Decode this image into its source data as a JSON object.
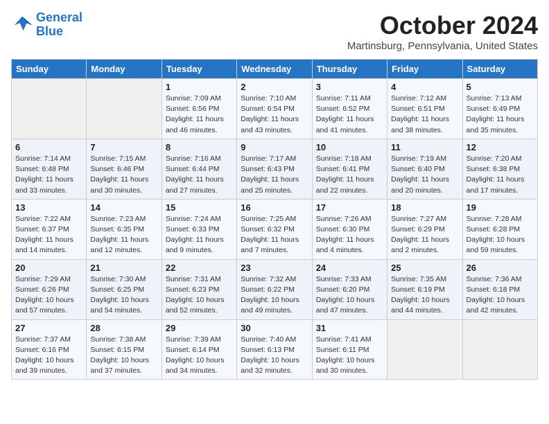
{
  "logo": {
    "line1": "General",
    "line2": "Blue"
  },
  "header": {
    "month": "October 2024",
    "location": "Martinsburg, Pennsylvania, United States"
  },
  "weekdays": [
    "Sunday",
    "Monday",
    "Tuesday",
    "Wednesday",
    "Thursday",
    "Friday",
    "Saturday"
  ],
  "weeks": [
    [
      {
        "num": "",
        "detail": ""
      },
      {
        "num": "",
        "detail": ""
      },
      {
        "num": "1",
        "detail": "Sunrise: 7:09 AM\nSunset: 6:56 PM\nDaylight: 11 hours and 46 minutes."
      },
      {
        "num": "2",
        "detail": "Sunrise: 7:10 AM\nSunset: 6:54 PM\nDaylight: 11 hours and 43 minutes."
      },
      {
        "num": "3",
        "detail": "Sunrise: 7:11 AM\nSunset: 6:52 PM\nDaylight: 11 hours and 41 minutes."
      },
      {
        "num": "4",
        "detail": "Sunrise: 7:12 AM\nSunset: 6:51 PM\nDaylight: 11 hours and 38 minutes."
      },
      {
        "num": "5",
        "detail": "Sunrise: 7:13 AM\nSunset: 6:49 PM\nDaylight: 11 hours and 35 minutes."
      }
    ],
    [
      {
        "num": "6",
        "detail": "Sunrise: 7:14 AM\nSunset: 6:48 PM\nDaylight: 11 hours and 33 minutes."
      },
      {
        "num": "7",
        "detail": "Sunrise: 7:15 AM\nSunset: 6:46 PM\nDaylight: 11 hours and 30 minutes."
      },
      {
        "num": "8",
        "detail": "Sunrise: 7:16 AM\nSunset: 6:44 PM\nDaylight: 11 hours and 27 minutes."
      },
      {
        "num": "9",
        "detail": "Sunrise: 7:17 AM\nSunset: 6:43 PM\nDaylight: 11 hours and 25 minutes."
      },
      {
        "num": "10",
        "detail": "Sunrise: 7:18 AM\nSunset: 6:41 PM\nDaylight: 11 hours and 22 minutes."
      },
      {
        "num": "11",
        "detail": "Sunrise: 7:19 AM\nSunset: 6:40 PM\nDaylight: 11 hours and 20 minutes."
      },
      {
        "num": "12",
        "detail": "Sunrise: 7:20 AM\nSunset: 6:38 PM\nDaylight: 11 hours and 17 minutes."
      }
    ],
    [
      {
        "num": "13",
        "detail": "Sunrise: 7:22 AM\nSunset: 6:37 PM\nDaylight: 11 hours and 14 minutes."
      },
      {
        "num": "14",
        "detail": "Sunrise: 7:23 AM\nSunset: 6:35 PM\nDaylight: 11 hours and 12 minutes."
      },
      {
        "num": "15",
        "detail": "Sunrise: 7:24 AM\nSunset: 6:33 PM\nDaylight: 11 hours and 9 minutes."
      },
      {
        "num": "16",
        "detail": "Sunrise: 7:25 AM\nSunset: 6:32 PM\nDaylight: 11 hours and 7 minutes."
      },
      {
        "num": "17",
        "detail": "Sunrise: 7:26 AM\nSunset: 6:30 PM\nDaylight: 11 hours and 4 minutes."
      },
      {
        "num": "18",
        "detail": "Sunrise: 7:27 AM\nSunset: 6:29 PM\nDaylight: 11 hours and 2 minutes."
      },
      {
        "num": "19",
        "detail": "Sunrise: 7:28 AM\nSunset: 6:28 PM\nDaylight: 10 hours and 59 minutes."
      }
    ],
    [
      {
        "num": "20",
        "detail": "Sunrise: 7:29 AM\nSunset: 6:26 PM\nDaylight: 10 hours and 57 minutes."
      },
      {
        "num": "21",
        "detail": "Sunrise: 7:30 AM\nSunset: 6:25 PM\nDaylight: 10 hours and 54 minutes."
      },
      {
        "num": "22",
        "detail": "Sunrise: 7:31 AM\nSunset: 6:23 PM\nDaylight: 10 hours and 52 minutes."
      },
      {
        "num": "23",
        "detail": "Sunrise: 7:32 AM\nSunset: 6:22 PM\nDaylight: 10 hours and 49 minutes."
      },
      {
        "num": "24",
        "detail": "Sunrise: 7:33 AM\nSunset: 6:20 PM\nDaylight: 10 hours and 47 minutes."
      },
      {
        "num": "25",
        "detail": "Sunrise: 7:35 AM\nSunset: 6:19 PM\nDaylight: 10 hours and 44 minutes."
      },
      {
        "num": "26",
        "detail": "Sunrise: 7:36 AM\nSunset: 6:18 PM\nDaylight: 10 hours and 42 minutes."
      }
    ],
    [
      {
        "num": "27",
        "detail": "Sunrise: 7:37 AM\nSunset: 6:16 PM\nDaylight: 10 hours and 39 minutes."
      },
      {
        "num": "28",
        "detail": "Sunrise: 7:38 AM\nSunset: 6:15 PM\nDaylight: 10 hours and 37 minutes."
      },
      {
        "num": "29",
        "detail": "Sunrise: 7:39 AM\nSunset: 6:14 PM\nDaylight: 10 hours and 34 minutes."
      },
      {
        "num": "30",
        "detail": "Sunrise: 7:40 AM\nSunset: 6:13 PM\nDaylight: 10 hours and 32 minutes."
      },
      {
        "num": "31",
        "detail": "Sunrise: 7:41 AM\nSunset: 6:11 PM\nDaylight: 10 hours and 30 minutes."
      },
      {
        "num": "",
        "detail": ""
      },
      {
        "num": "",
        "detail": ""
      }
    ]
  ]
}
